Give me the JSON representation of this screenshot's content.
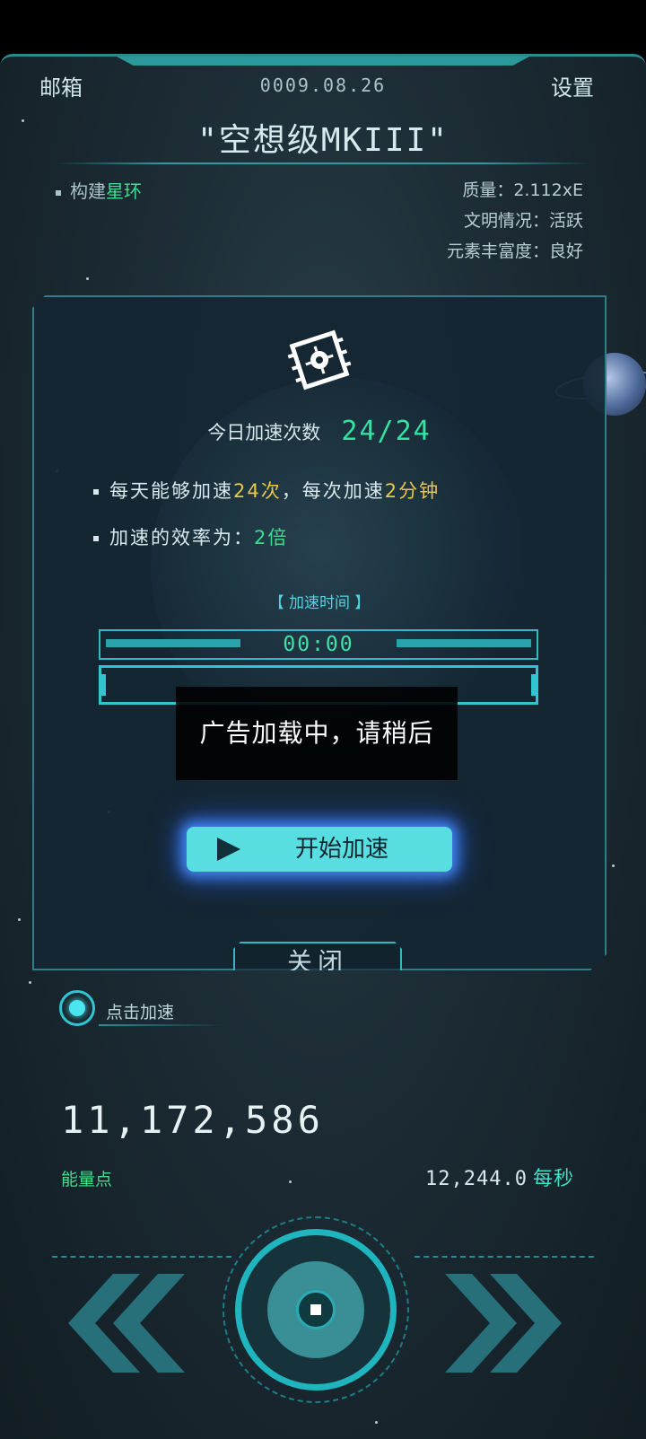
{
  "header": {
    "mailbox_label": "邮箱",
    "date": "0009.08.26",
    "settings_label": "设置",
    "planet_name": "\"空想级MKIII\""
  },
  "planet_info": {
    "build_prefix": "构建",
    "build_highlight": "星环",
    "mass": "质量：2.112xE",
    "civilization": "文明情况：活跃",
    "element_abundance": "元素丰富度：良好"
  },
  "dialog": {
    "icon": "chip-gear-icon",
    "count_label": "今日加速次数",
    "count_value": "24/24",
    "info1_prefix": "每天能够加速",
    "info1_times": "24次",
    "info1_mid": "，每次加速",
    "info1_duration": "2分钟",
    "info2_prefix": "加速的效率为：",
    "info2_value": "2倍",
    "time_title": "【 加速时间 】",
    "time_value": "00:00",
    "start_button": "开始加速",
    "close_button": "关闭"
  },
  "toast": {
    "text": "广告加载中，请稍后"
  },
  "click_accel": {
    "label": "点击加速"
  },
  "stats": {
    "energy_value": "11,172,586",
    "energy_label": "能量点",
    "rate_value": "12,244.0",
    "rate_unit": "每秒"
  },
  "nav": {
    "left_icon": "double-chevron-left-icon",
    "right_icon": "double-chevron-right-icon",
    "center_icon": "main-core-button-icon"
  },
  "colors": {
    "accent_cyan": "#31c5d2",
    "highlight_green": "#38e08c",
    "highlight_yellow": "#e7c84a",
    "background": "#1c2b34"
  }
}
